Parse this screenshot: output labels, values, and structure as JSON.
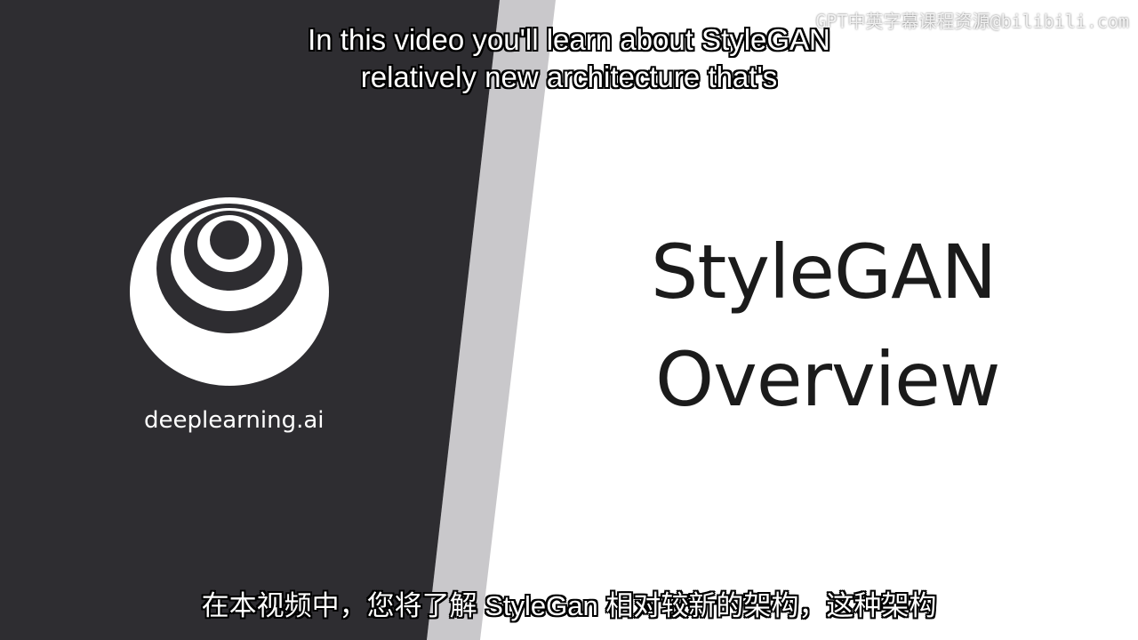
{
  "slide": {
    "brand": "deeplearning.ai",
    "title_line1": "StyleGAN",
    "title_line2": "Overview"
  },
  "subtitles": {
    "english_line1": "In this video you'll learn about StyleGAN",
    "english_line2": "relatively new architecture that's",
    "chinese": "在本视频中，您将了解 StyleGan 相对较新的架构，这种架构"
  },
  "watermark": "GPT中英字幕课程资源@bilibili.com",
  "colors": {
    "dark_panel": "#2e2d31",
    "divider_stripe": "#c9c8cb",
    "light_panel": "#ffffff",
    "title_text": "#1b1b1b",
    "logo": "#ffffff"
  },
  "icons": {
    "logo": "deeplearning-ai-logo"
  }
}
